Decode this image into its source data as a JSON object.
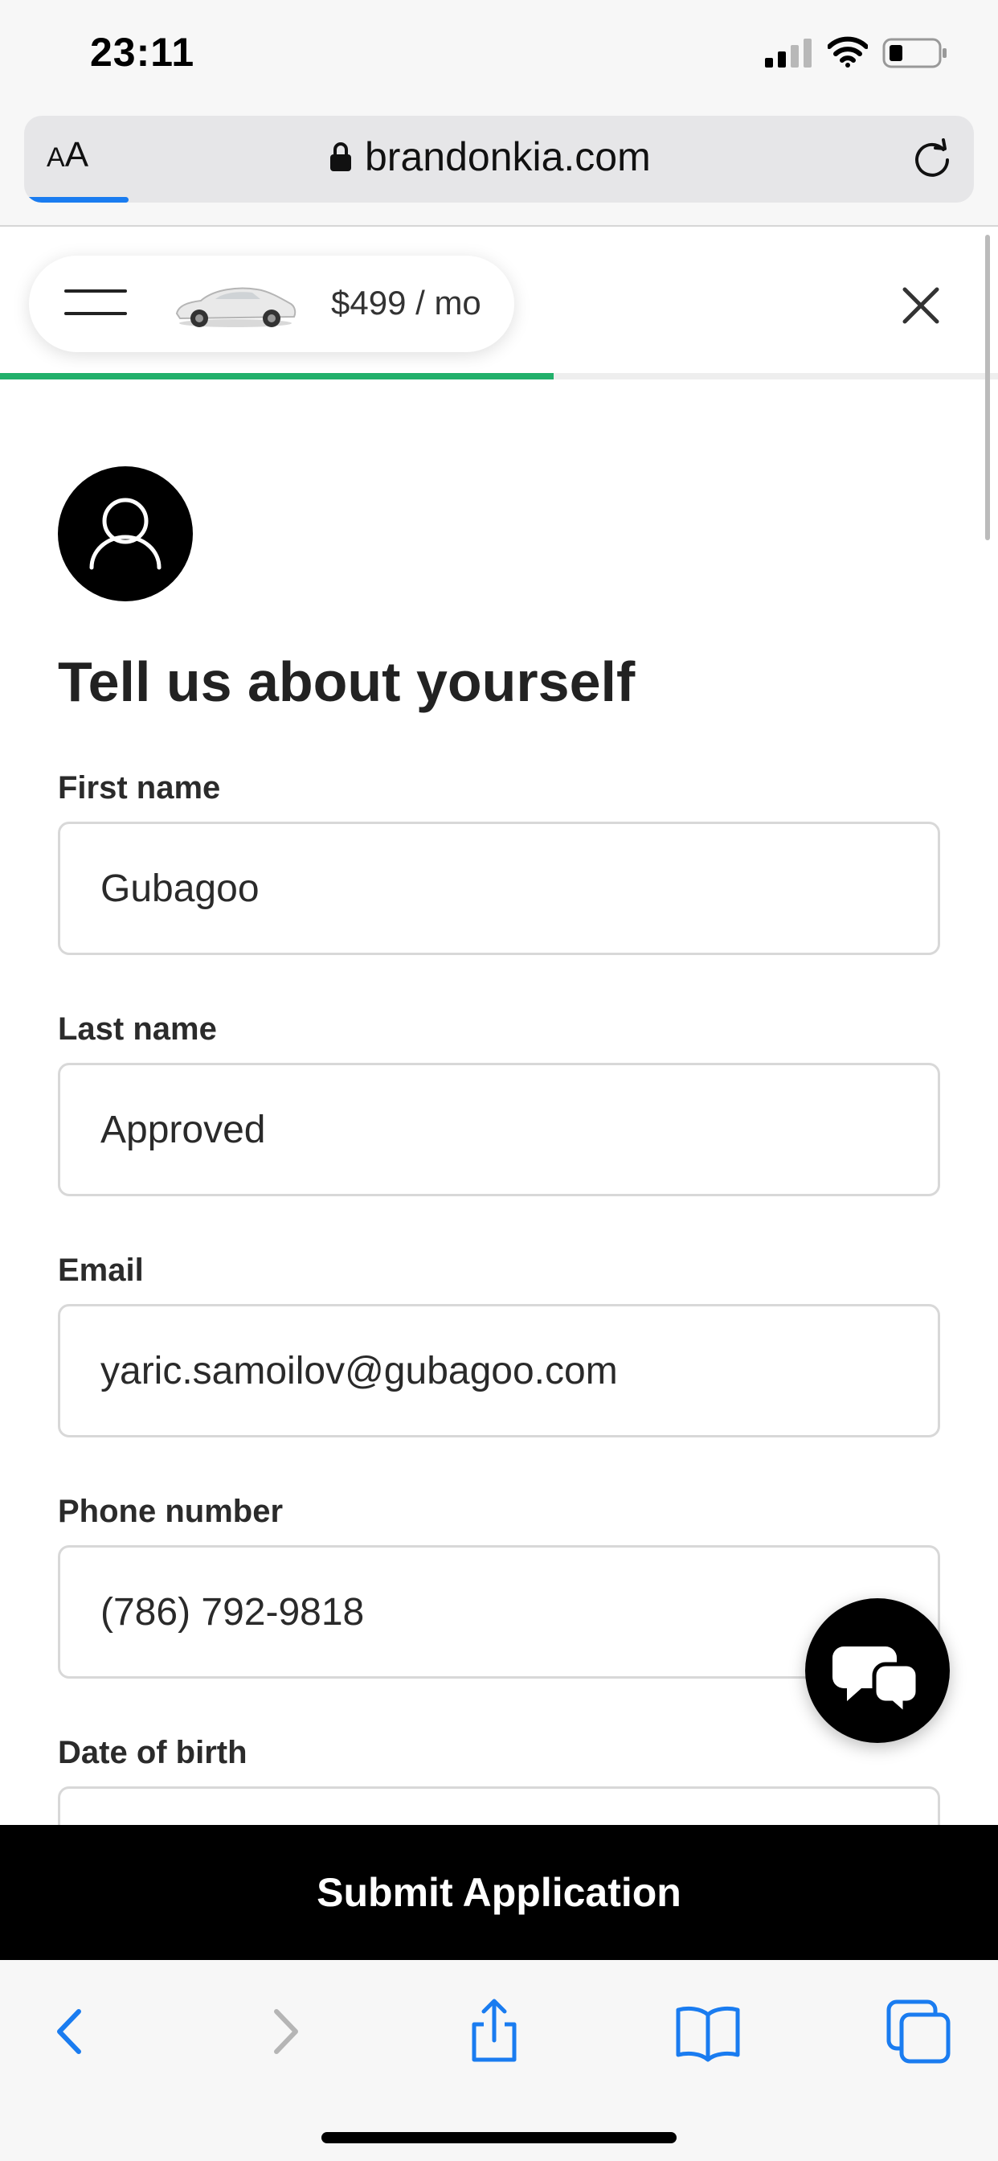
{
  "status_bar": {
    "time": "23:11"
  },
  "browser": {
    "text_size_label_small": "A",
    "text_size_label_large": "A",
    "url": "brandonkia.com",
    "load_progress_fraction": 0.11
  },
  "header": {
    "price": "$499 / mo",
    "step_progress_fraction": 0.555
  },
  "form": {
    "title": "Tell us about yourself",
    "fields": [
      {
        "label": "First name",
        "value": "Gubagoo"
      },
      {
        "label": "Last name",
        "value": "Approved"
      },
      {
        "label": "Email",
        "value": "yaric.samoilov@gubagoo.com"
      },
      {
        "label": "Phone number",
        "value": "(786) 792-9818"
      },
      {
        "label": "Date of birth",
        "value": ""
      }
    ],
    "submit_label": "Submit Application"
  },
  "colors": {
    "accent_progress": "#22b06b",
    "browser_load": "#1a7cf0",
    "toolbar_icons": "#1a7cf0",
    "submit_background": "#000000"
  },
  "icons": {
    "status": [
      "signal-icon",
      "wifi-icon",
      "battery-icon"
    ],
    "address_bar": [
      "lock-icon",
      "reload-icon"
    ],
    "header": [
      "menu-icon",
      "car-image",
      "close-icon"
    ],
    "toolbar": [
      "back-icon",
      "forward-icon",
      "share-icon",
      "bookmarks-icon",
      "tabs-icon"
    ],
    "page": [
      "user-icon",
      "chat-icon"
    ]
  }
}
